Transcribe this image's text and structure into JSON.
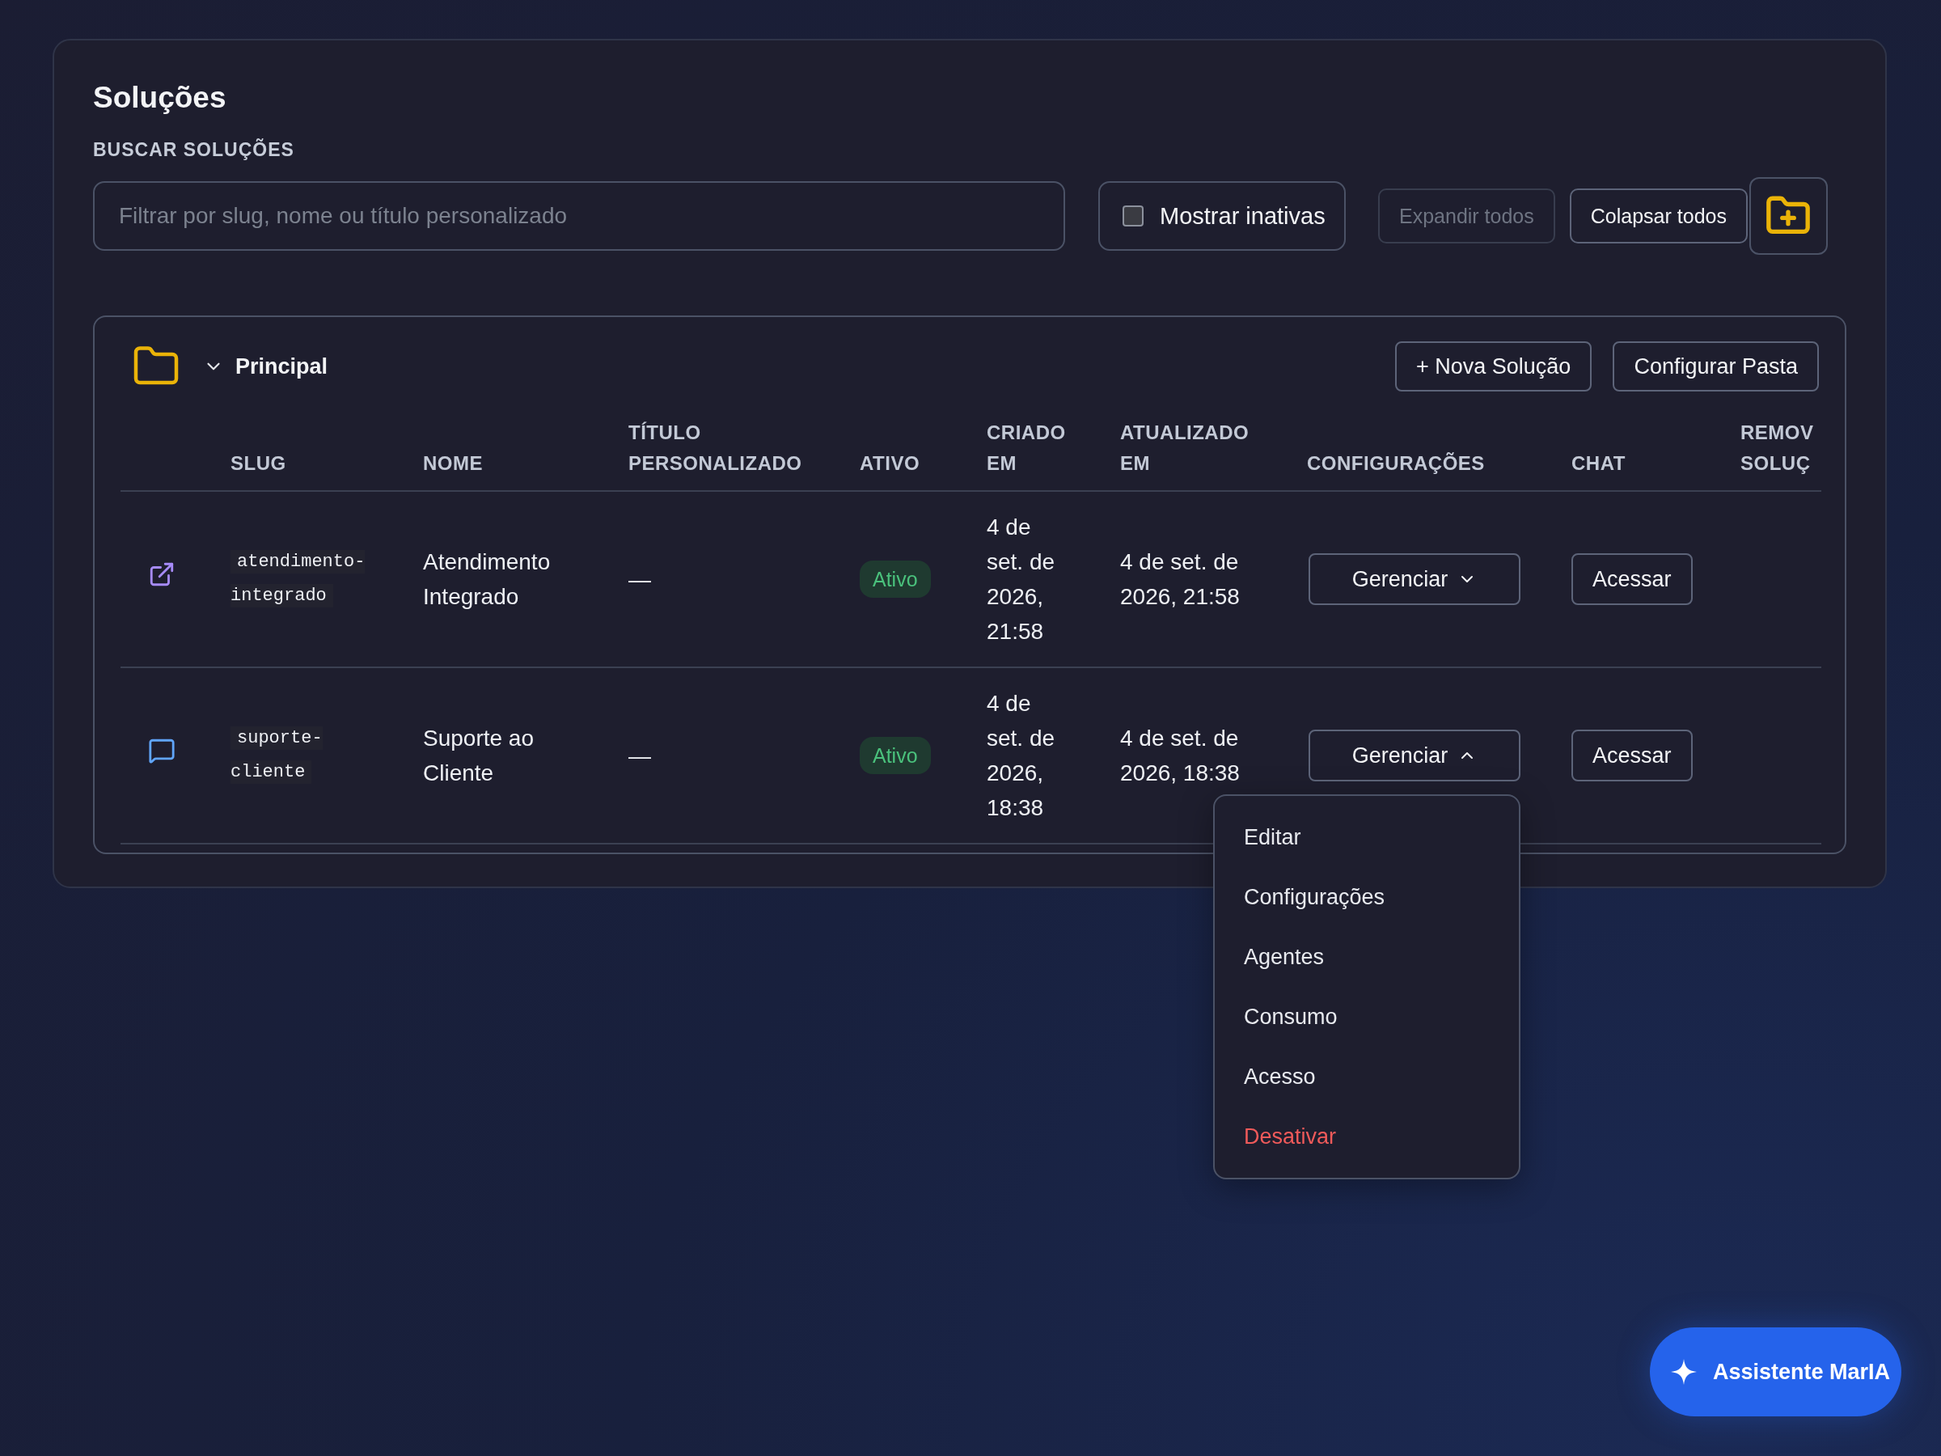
{
  "page_title": "Soluções",
  "search": {
    "label": "BUSCAR SOLUÇÕES",
    "placeholder": "Filtrar por slug, nome ou título personalizado"
  },
  "show_inactive": {
    "label": "Mostrar inativas",
    "checked": false
  },
  "toolbar_buttons": [
    {
      "label": "Expandir todos",
      "disabled": true
    },
    {
      "label": "Colapsar todos",
      "disabled": false
    }
  ],
  "folder": {
    "name": "Principal",
    "expanded": true,
    "buttons": [
      "+ Nova Solução",
      "Configurar Pasta"
    ],
    "table": {
      "columns": [
        "SLUG",
        "NOME",
        "TÍTULO PERSONALIZADO",
        "ATIVO",
        "CRIADO EM",
        "ATUALIZADO EM",
        "CONFIGURAÇÕES",
        "CHAT",
        "REMOV SOLUÇ"
      ],
      "rows": [
        {
          "kind": "link",
          "slug": "atendimento-integrado",
          "name": "Atendimento Integrado",
          "custom_title": "—",
          "status": "Ativo",
          "created": "4 de set. de 2026, 21:58",
          "updated": "4 de set. de 2026, 21:58",
          "manage": {
            "label": "Gerenciar",
            "expanded": false
          },
          "chat": "Acessar"
        },
        {
          "kind": "chat",
          "slug": "suporte-cliente",
          "name": "Suporte ao Cliente",
          "custom_title": "—",
          "status": "Ativo",
          "created": "4 de set. de 2026, 18:38",
          "updated": "4 de set. de 2026, 18:38",
          "manage": {
            "label": "Gerenciar",
            "expanded": true,
            "menu_items": [
              {
                "label": "Editar",
                "danger": false
              },
              {
                "label": "Configurações",
                "danger": false
              },
              {
                "label": "Agentes",
                "danger": false
              },
              {
                "label": "Consumo",
                "danger": false
              },
              {
                "label": "Acesso",
                "danger": false
              },
              {
                "label": "Desativar",
                "danger": true
              }
            ]
          },
          "chat": "Acessar"
        }
      ]
    }
  },
  "assistant_button": "Assistente MarIA"
}
